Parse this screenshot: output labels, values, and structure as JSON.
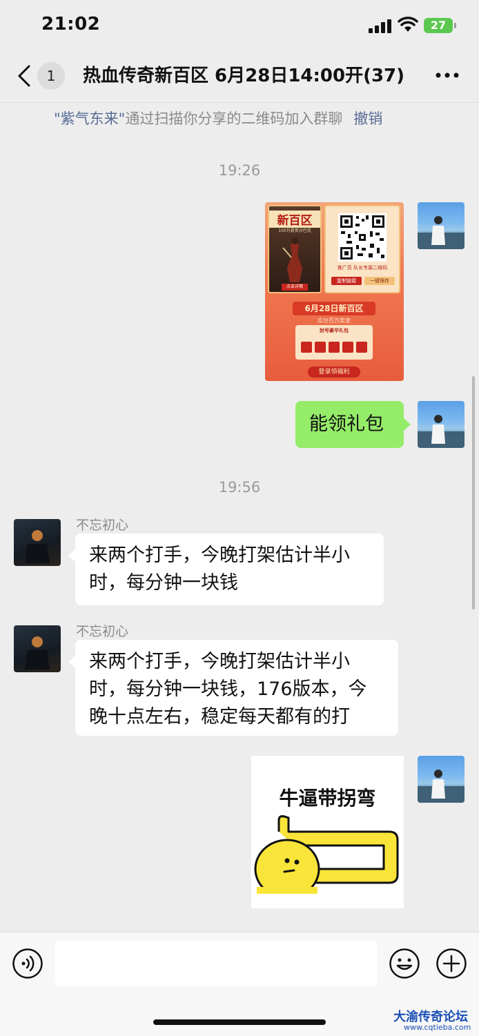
{
  "status_bar": {
    "time": "21:02",
    "battery": "27"
  },
  "header": {
    "back_count": "1",
    "title": "热血传奇新百区 6月28日14:00开(37)"
  },
  "notice": {
    "quoted_name": "\"紫气东来\"",
    "text": "通过扫描你分享的二维码加入群聊",
    "undo": "撤销"
  },
  "messages": [
    {
      "timestamp": "19:26"
    },
    {
      "poster": {
        "banner": "新百区",
        "sub": "100万悬赏沙巴克",
        "qr_caption": "推广员 队长专属二维码",
        "copy": "复制链接",
        "save": "一键保存",
        "date_title": "6月28日新百区",
        "reward": "瓜分百万奖金",
        "pack": "封号豪华礼包",
        "login": "登录领福利",
        "detail": "点击详情"
      }
    },
    {
      "text": "能领礼包"
    },
    {
      "timestamp": "19:56"
    },
    {
      "sender": "不忘初心",
      "text": "来两个打手，今晚打架估计半小时，每分钟一块钱"
    },
    {
      "sender": "不忘初心",
      "text": "来两个打手，今晚打架估计半小时，每分钟一块钱，176版本，今晚十点左右，稳定每天都有的打"
    },
    {
      "sticker_text": "牛逼带拐弯"
    }
  ],
  "watermark": {
    "name": "大渝传奇论坛",
    "url": "www.cqtieba.com"
  },
  "colors": {
    "bubble_green": "#95ec69",
    "link_blue": "#576b95",
    "background": "#ededed"
  }
}
